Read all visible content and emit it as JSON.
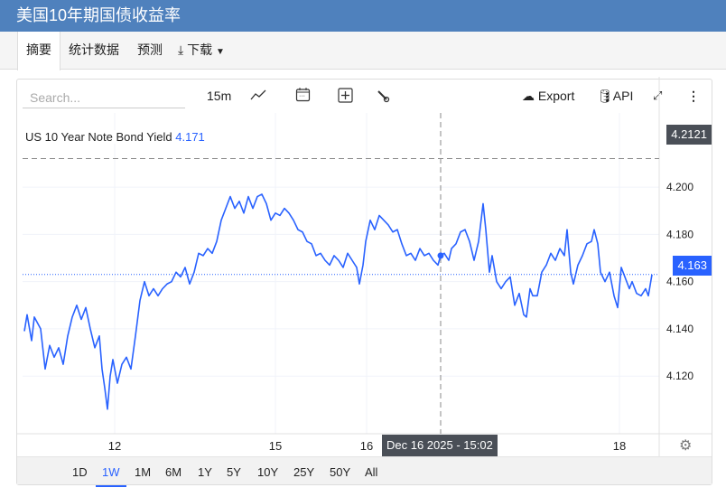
{
  "title": "美国10年期国债收益率",
  "tabs": [
    {
      "label": "摘要"
    },
    {
      "label": "统计数据"
    },
    {
      "label": "预测"
    },
    {
      "label": "下载"
    }
  ],
  "toolbar": {
    "search_placeholder": "Search...",
    "interval": "15m",
    "export": "Export",
    "api": "API"
  },
  "legend": {
    "name": "US 10 Year Note Bond Yield",
    "value": "4.171"
  },
  "crosshair": {
    "price_label": "4.2121",
    "time_label": "Dec 16 2025 - 15:02",
    "price": 4.2121,
    "t": 463
  },
  "last_price": {
    "label": "4.163",
    "value": 4.163
  },
  "ranges": [
    "1D",
    "1W",
    "1M",
    "6M",
    "1Y",
    "5Y",
    "10Y",
    "25Y",
    "50Y",
    "All"
  ],
  "active_range": "1W",
  "colors": {
    "line": "#2962ff",
    "header": "#4f81bd",
    "tag": "#4a4f57"
  },
  "chart_data": {
    "type": "line",
    "title": "US 10 Year Note Bond Yield",
    "ylim": [
      4.0956,
      4.2314
    ],
    "xlim": [
      0,
      705
    ],
    "yticks": [
      "4.200",
      "4.180",
      "4.160",
      "4.140",
      "4.120"
    ],
    "xticks": [
      {
        "label": "12",
        "t": 102
      },
      {
        "label": "15",
        "t": 280
      },
      {
        "label": "16",
        "t": 381
      },
      {
        "label": "18",
        "t": 661
      }
    ],
    "points": [
      [
        2,
        4.139
      ],
      [
        5,
        4.146
      ],
      [
        10,
        4.135
      ],
      [
        13,
        4.145
      ],
      [
        20,
        4.14
      ],
      [
        25,
        4.123
      ],
      [
        30,
        4.133
      ],
      [
        35,
        4.128
      ],
      [
        40,
        4.132
      ],
      [
        45,
        4.125
      ],
      [
        50,
        4.137
      ],
      [
        55,
        4.145
      ],
      [
        60,
        4.15
      ],
      [
        65,
        4.144
      ],
      [
        70,
        4.149
      ],
      [
        75,
        4.14
      ],
      [
        80,
        4.132
      ],
      [
        85,
        4.137
      ],
      [
        88,
        4.123
      ],
      [
        91,
        4.115
      ],
      [
        94,
        4.106
      ],
      [
        97,
        4.12
      ],
      [
        100,
        4.127
      ],
      [
        105,
        4.117
      ],
      [
        110,
        4.125
      ],
      [
        115,
        4.128
      ],
      [
        120,
        4.123
      ],
      [
        125,
        4.137
      ],
      [
        130,
        4.152
      ],
      [
        135,
        4.16
      ],
      [
        140,
        4.154
      ],
      [
        145,
        4.157
      ],
      [
        150,
        4.154
      ],
      [
        155,
        4.157
      ],
      [
        160,
        4.159
      ],
      [
        165,
        4.16
      ],
      [
        170,
        4.164
      ],
      [
        175,
        4.162
      ],
      [
        180,
        4.166
      ],
      [
        185,
        4.159
      ],
      [
        190,
        4.164
      ],
      [
        195,
        4.172
      ],
      [
        200,
        4.171
      ],
      [
        205,
        4.174
      ],
      [
        210,
        4.172
      ],
      [
        215,
        4.177
      ],
      [
        220,
        4.186
      ],
      [
        225,
        4.191
      ],
      [
        230,
        4.196
      ],
      [
        235,
        4.191
      ],
      [
        240,
        4.194
      ],
      [
        245,
        4.189
      ],
      [
        250,
        4.196
      ],
      [
        255,
        4.191
      ],
      [
        260,
        4.196
      ],
      [
        265,
        4.197
      ],
      [
        270,
        4.193
      ],
      [
        275,
        4.186
      ],
      [
        280,
        4.189
      ],
      [
        285,
        4.188
      ],
      [
        290,
        4.191
      ],
      [
        295,
        4.189
      ],
      [
        300,
        4.186
      ],
      [
        305,
        4.182
      ],
      [
        310,
        4.181
      ],
      [
        315,
        4.177
      ],
      [
        320,
        4.176
      ],
      [
        325,
        4.171
      ],
      [
        330,
        4.172
      ],
      [
        335,
        4.169
      ],
      [
        340,
        4.167
      ],
      [
        345,
        4.171
      ],
      [
        350,
        4.169
      ],
      [
        355,
        4.166
      ],
      [
        360,
        4.172
      ],
      [
        365,
        4.169
      ],
      [
        370,
        4.166
      ],
      [
        373,
        4.159
      ],
      [
        377,
        4.167
      ],
      [
        380,
        4.177
      ],
      [
        385,
        4.186
      ],
      [
        390,
        4.182
      ],
      [
        395,
        4.188
      ],
      [
        400,
        4.186
      ],
      [
        405,
        4.184
      ],
      [
        410,
        4.181
      ],
      [
        415,
        4.182
      ],
      [
        420,
        4.176
      ],
      [
        425,
        4.171
      ],
      [
        430,
        4.172
      ],
      [
        435,
        4.169
      ],
      [
        440,
        4.174
      ],
      [
        445,
        4.171
      ],
      [
        450,
        4.172
      ],
      [
        455,
        4.169
      ],
      [
        460,
        4.167
      ],
      [
        463,
        4.171
      ],
      [
        467,
        4.172
      ],
      [
        472,
        4.169
      ],
      [
        475,
        4.174
      ],
      [
        480,
        4.176
      ],
      [
        485,
        4.181
      ],
      [
        490,
        4.182
      ],
      [
        495,
        4.177
      ],
      [
        500,
        4.169
      ],
      [
        505,
        4.177
      ],
      [
        510,
        4.193
      ],
      [
        513,
        4.182
      ],
      [
        517,
        4.164
      ],
      [
        520,
        4.171
      ],
      [
        525,
        4.16
      ],
      [
        530,
        4.157
      ],
      [
        535,
        4.16
      ],
      [
        540,
        4.162
      ],
      [
        545,
        4.15
      ],
      [
        550,
        4.155
      ],
      [
        555,
        4.146
      ],
      [
        558,
        4.145
      ],
      [
        562,
        4.157
      ],
      [
        565,
        4.154
      ],
      [
        570,
        4.154
      ],
      [
        575,
        4.164
      ],
      [
        580,
        4.167
      ],
      [
        585,
        4.172
      ],
      [
        590,
        4.169
      ],
      [
        595,
        4.174
      ],
      [
        600,
        4.171
      ],
      [
        603,
        4.182
      ],
      [
        607,
        4.164
      ],
      [
        610,
        4.159
      ],
      [
        615,
        4.167
      ],
      [
        620,
        4.171
      ],
      [
        625,
        4.176
      ],
      [
        630,
        4.177
      ],
      [
        633,
        4.182
      ],
      [
        637,
        4.176
      ],
      [
        640,
        4.164
      ],
      [
        645,
        4.16
      ],
      [
        650,
        4.164
      ],
      [
        655,
        4.154
      ],
      [
        659,
        4.149
      ],
      [
        663,
        4.166
      ],
      [
        667,
        4.162
      ],
      [
        672,
        4.157
      ],
      [
        675,
        4.16
      ],
      [
        680,
        4.155
      ],
      [
        685,
        4.154
      ],
      [
        690,
        4.157
      ],
      [
        693,
        4.154
      ],
      [
        697,
        4.163
      ]
    ]
  }
}
